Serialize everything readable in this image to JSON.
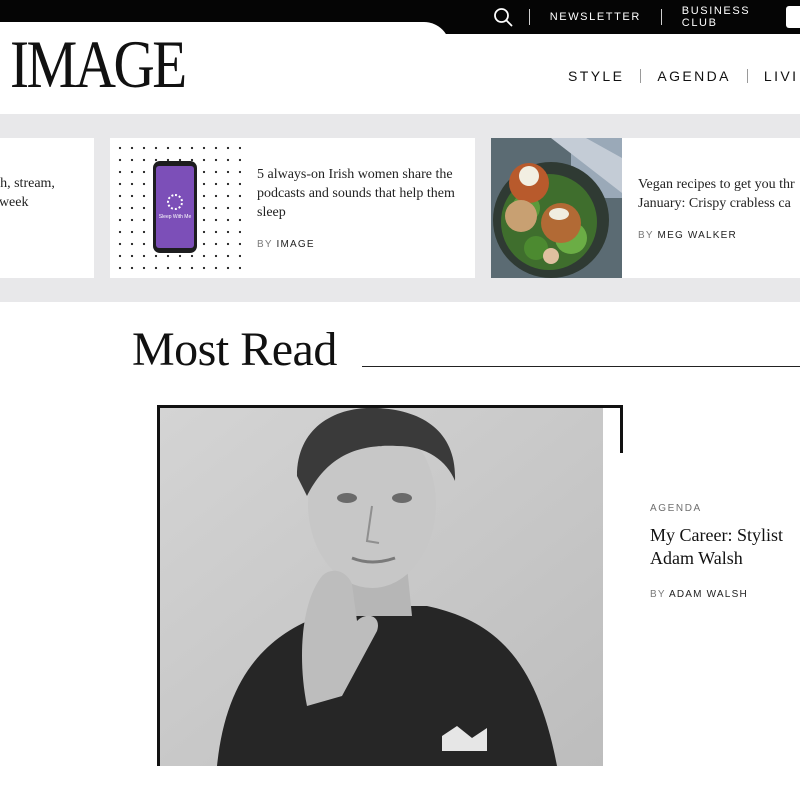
{
  "header": {
    "logo": "IMAGE",
    "utility": {
      "search_icon": "search-icon",
      "links": [
        "NEWSLETTER",
        "BUSINESS CLUB"
      ]
    },
    "nav": [
      "STYLE",
      "AGENDA",
      "LIVI"
    ]
  },
  "carousel": {
    "cards": [
      {
        "title_line1": "tch, stream,",
        "title_line2": "s week"
      },
      {
        "title": "5 always-on Irish women share the podcasts and sounds that help them sleep",
        "by": "BY",
        "author": "IMAGE",
        "phone_text": "Sleep With Me"
      },
      {
        "title_line1": "Vegan recipes to get you thr",
        "title_line2": "January: Crispy crabless ca",
        "by": "BY",
        "author": "MEG WALKER"
      }
    ]
  },
  "most_read": {
    "heading": "Most Read",
    "feature": {
      "category": "AGENDA",
      "title": "My Career: Stylist Adam Walsh",
      "by": "BY",
      "author": "ADAM WALSH"
    }
  },
  "colors": {
    "topbar": "#050505",
    "strip": "#e8e8ea",
    "phone_screen": "#7c4fb8"
  }
}
